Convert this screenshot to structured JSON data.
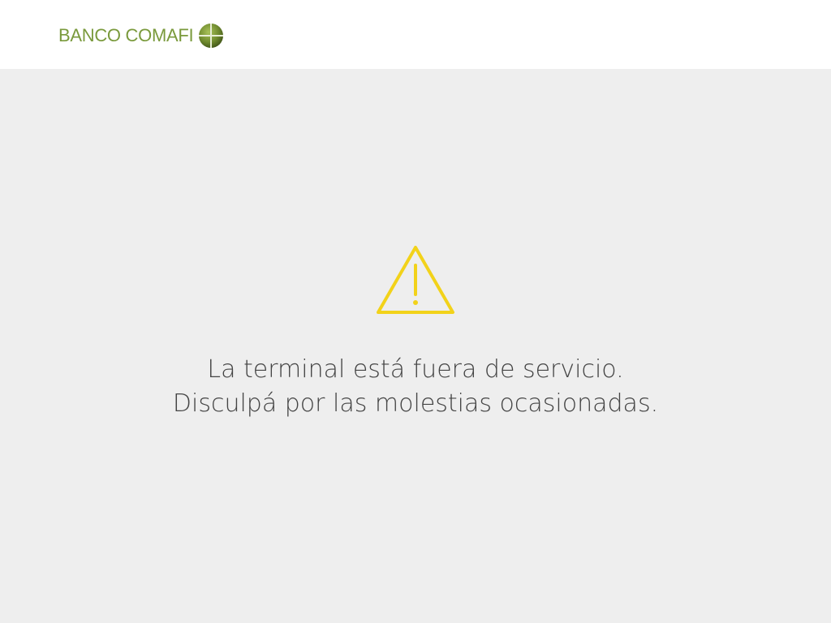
{
  "header": {
    "brand_name": "BANCO COMAFI",
    "logo_icon": "comafi-globe-icon",
    "brand_color": "#7a9a3c"
  },
  "main": {
    "status_icon": "warning-triangle-icon",
    "status_icon_color": "#f2d21a",
    "message_line_1": "La terminal está fuera de servicio.",
    "message_line_2": "Disculpá por las molestias ocasionadas."
  }
}
